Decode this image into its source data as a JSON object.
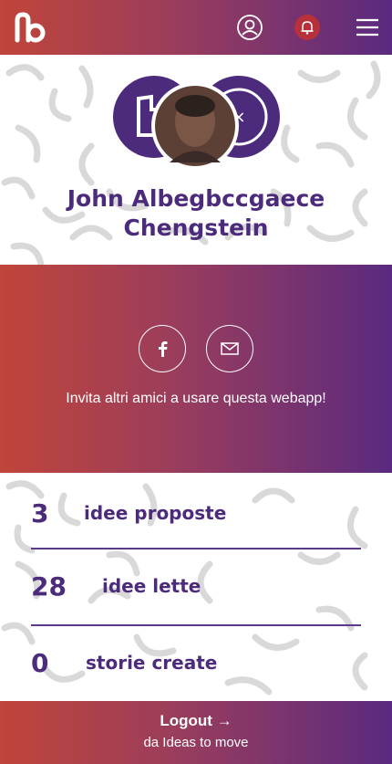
{
  "header": {
    "logo_icon": "ideas-to-move-logo-icon",
    "user_icon": "user-circle-icon",
    "notification_icon": "bell-icon",
    "menu_icon": "hamburger-menu-icon"
  },
  "profile": {
    "name_line1": "John Albegbccgaece",
    "name_line2": "Chengstein"
  },
  "invite": {
    "facebook_icon": "facebook-icon",
    "email_icon": "mail-icon",
    "text": "Invita altri amici a usare questa webapp!"
  },
  "stats": [
    {
      "value": "3",
      "label": "idee proposte"
    },
    {
      "value": "28",
      "label": "idee lette"
    },
    {
      "value": "0",
      "label": "storie create"
    }
  ],
  "footer": {
    "logout_label": "Logout →",
    "subtitle": "da Ideas to move"
  },
  "colors": {
    "gradient_start": "#c0453a",
    "gradient_end": "#5a2a80",
    "accent_text": "#4c2a7c"
  }
}
